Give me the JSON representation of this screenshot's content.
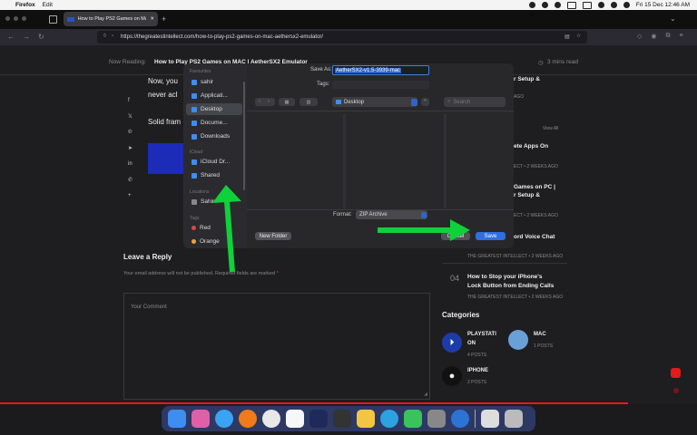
{
  "menubar": {
    "app": "Firefox",
    "edit": "Edit",
    "datetime": "Fri 15 Dec  12:46 AM"
  },
  "tab": {
    "title": "How to Play PS2 Games on Mac"
  },
  "url": {
    "value": "https://thegreatestintellect.com/how-to-play-ps2-games-on-mac-aethersx2-emulator/"
  },
  "article": {
    "now_reading_label": "Now Reading:",
    "now_reading_title": "How to Play PS2 Games on MAC | AetherSX2 Emulator",
    "read_time": "3 mins read",
    "para1a": "Now, you",
    "para1b": "never acl",
    "para2": "Solid fram",
    "leave_reply": "Leave a Reply",
    "email_note": "Your email address will not be published. Required fields are marked",
    "comment_placeholder": "Your Comment"
  },
  "right_sidebar": {
    "frag1": "r Setup &",
    "frag2": "AGO",
    "view_all": "View All",
    "frag3": "ete Apps On",
    "frag4": "ECT • 2 WEEKS AGO",
    "frag5": "Games on PC |",
    "frag6": "r Setup &",
    "frag7": "ECT • 2 WEEKS AGO",
    "frag8": "ord Voice Chat",
    "frag9": "THE GREATEST INTELLECT • 2 WEEKS AGO",
    "item4_num": "04",
    "item4_title1": "How to Stop your iPhone's",
    "item4_title2": "Lock Button from Ending Calls",
    "item4_meta": "THE GREATEST INTELLECT • 2 WEEKS AGO",
    "categories": "Categories",
    "cat1": "PLAYSTATI",
    "cat1b": "ON",
    "cat1_posts": "4 POSTS",
    "cat2": "MAC",
    "cat2_posts": "1 POSTS",
    "cat3": "IPHONE",
    "cat3_posts": "2 POSTS"
  },
  "dialog": {
    "sidebar": {
      "favorites": "Favourites",
      "items": [
        "sahir",
        "Applicati...",
        "Desktop",
        "Docume...",
        "Downloads"
      ],
      "icloud": "iCloud",
      "icloud_items": [
        "iCloud Dr...",
        "Shared"
      ],
      "locations": "Locations",
      "loc_item": "Sahir",
      "tags": "Tags",
      "tag1": "Red",
      "tag2": "Orange"
    },
    "save_as_label": "Save As:",
    "save_as_value": "AetherSX2-v1.5-3939-mac",
    "tags_label": "Tags:",
    "location": "Desktop",
    "search_placeholder": "Search",
    "format_label": "Format:",
    "format_value": "ZIP Archive",
    "new_folder": "New Folder",
    "cancel": "Cancel",
    "save": "Save"
  }
}
